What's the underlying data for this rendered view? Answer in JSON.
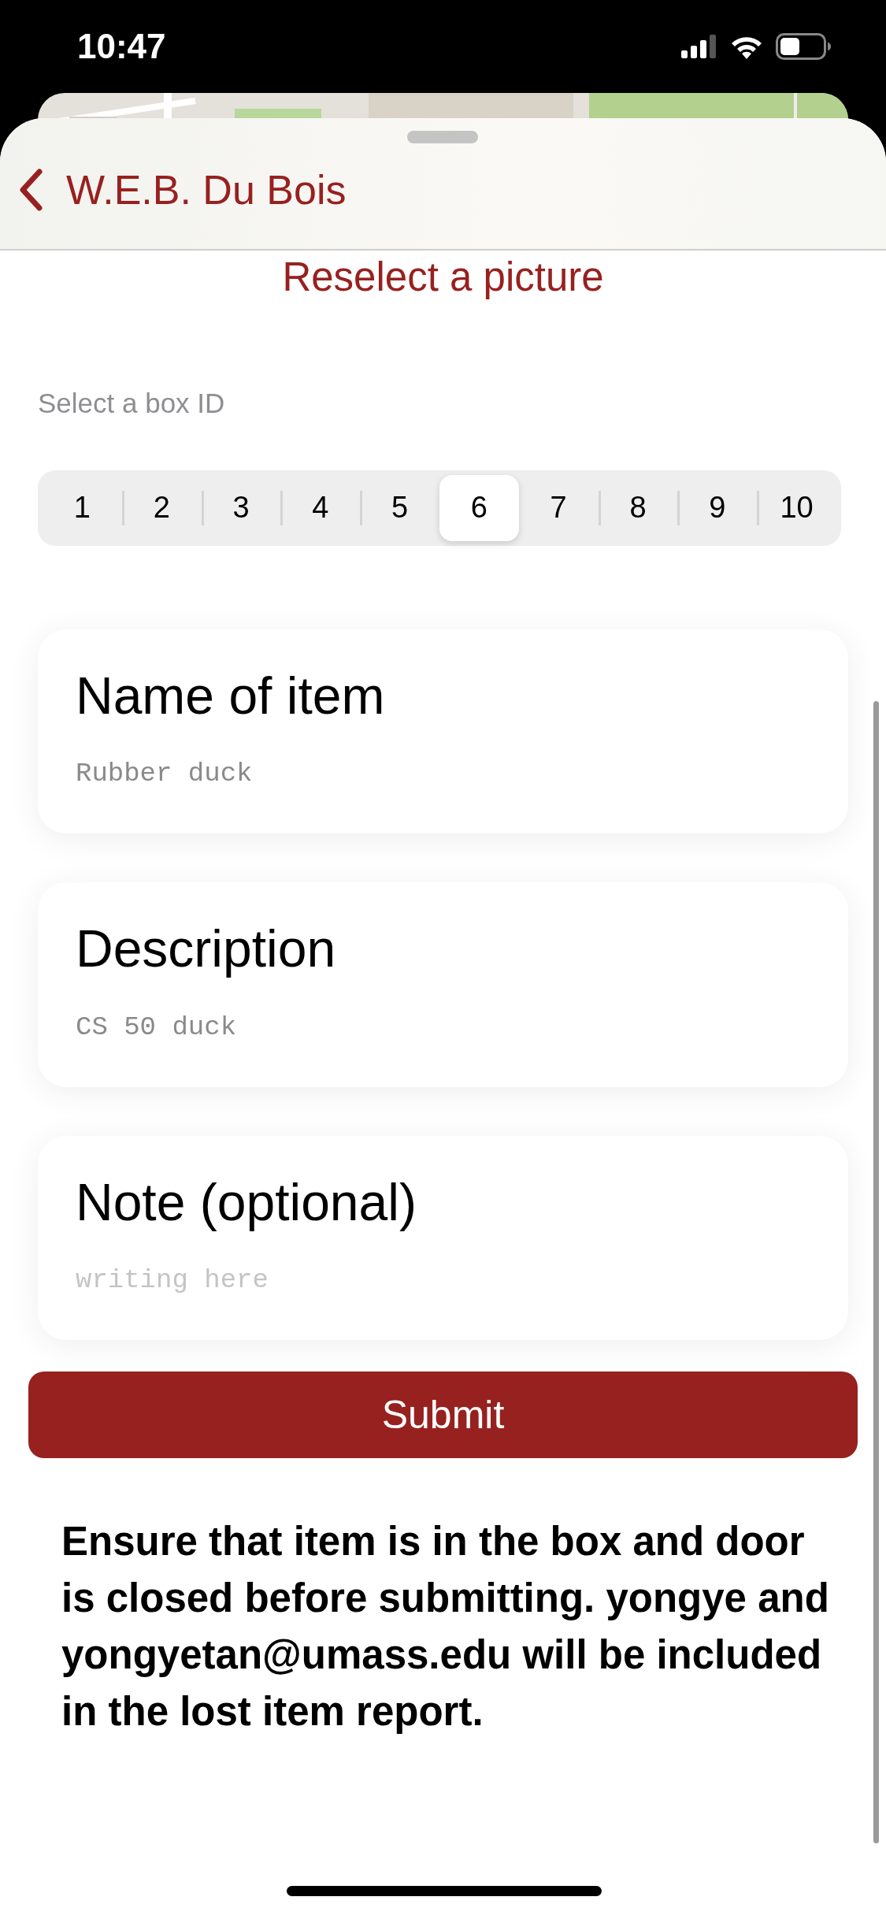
{
  "status_bar": {
    "time": "10:47"
  },
  "header": {
    "back_label": "W.E.B. Du Bois"
  },
  "reselect_link": "Reselect a picture",
  "box_picker": {
    "label": "Select a box ID",
    "options": [
      {
        "label": "1",
        "selected": false
      },
      {
        "label": "2",
        "selected": false
      },
      {
        "label": "3",
        "selected": false
      },
      {
        "label": "4",
        "selected": false
      },
      {
        "label": "5",
        "selected": false
      },
      {
        "label": "6",
        "selected": true
      },
      {
        "label": "7",
        "selected": false
      },
      {
        "label": "8",
        "selected": false
      },
      {
        "label": "9",
        "selected": false
      },
      {
        "label": "10",
        "selected": false
      }
    ]
  },
  "fields": [
    {
      "label": "Name of item",
      "value": "Rubber duck"
    },
    {
      "label": "Description",
      "value": "CS 50 duck"
    },
    {
      "label": "Note (optional)",
      "placeholder": "writing here"
    }
  ],
  "submit_button": "Submit",
  "notice": "Ensure that item is in the box and door is closed before submitting. yongye and yongyetan@umass.edu will be included in the lost item report."
}
